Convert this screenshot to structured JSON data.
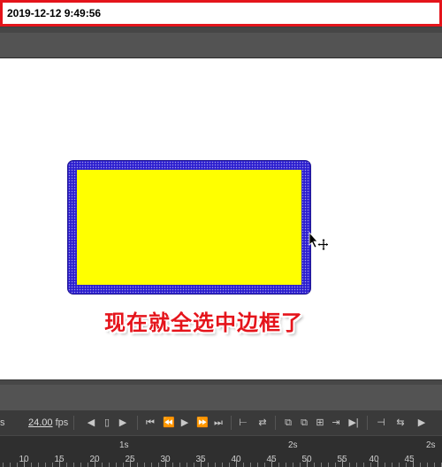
{
  "timestamp": "2019-12-12 9:49:56",
  "caption": "现在就全选中边框了",
  "colors": {
    "fill": "#ffff00",
    "stroke": "#2c1fcf",
    "caption": "#e5141b",
    "timestamp_border": "#e4141b"
  },
  "timeline": {
    "frame_rate_left": "s",
    "fps_value": "24.00",
    "fps_unit": "fps",
    "controls": [
      {
        "name": "loop-back-icon",
        "glyph": "◀"
      },
      {
        "name": "onion-skin-icon",
        "glyph": "▯"
      },
      {
        "name": "play-forward-icon",
        "glyph": "▶"
      },
      {
        "name": "first-frame-icon",
        "glyph": "⏮"
      },
      {
        "name": "step-back-icon",
        "glyph": "⏪"
      },
      {
        "name": "play-icon",
        "glyph": "▶"
      },
      {
        "name": "step-forward-icon",
        "glyph": "⏩"
      },
      {
        "name": "last-frame-icon",
        "glyph": "⏭"
      },
      {
        "name": "center-frame-icon",
        "glyph": "⊢"
      },
      {
        "name": "loop-icon",
        "glyph": "⇄"
      },
      {
        "name": "copy-frames-icon",
        "glyph": "⧉"
      },
      {
        "name": "paste-frames-icon",
        "glyph": "⧉"
      },
      {
        "name": "clip-icon",
        "glyph": "⊞"
      },
      {
        "name": "insert-frame-icon",
        "glyph": "⇥"
      },
      {
        "name": "tween-icon",
        "glyph": "▶|"
      },
      {
        "name": "keyframe-icon",
        "glyph": "⊣"
      },
      {
        "name": "swap-icon",
        "glyph": "⇆"
      },
      {
        "name": "more-icon",
        "glyph": "▶"
      }
    ],
    "seconds": [
      {
        "label": "1s"
      },
      {
        "label": "2s"
      },
      {
        "label": "2s"
      }
    ],
    "frame_numbers": [
      "10",
      "15",
      "20",
      "25",
      "30",
      "35",
      "40",
      "45",
      "50",
      "55",
      "40",
      "45"
    ]
  },
  "icons": {
    "cursor": "move-cursor-icon"
  }
}
